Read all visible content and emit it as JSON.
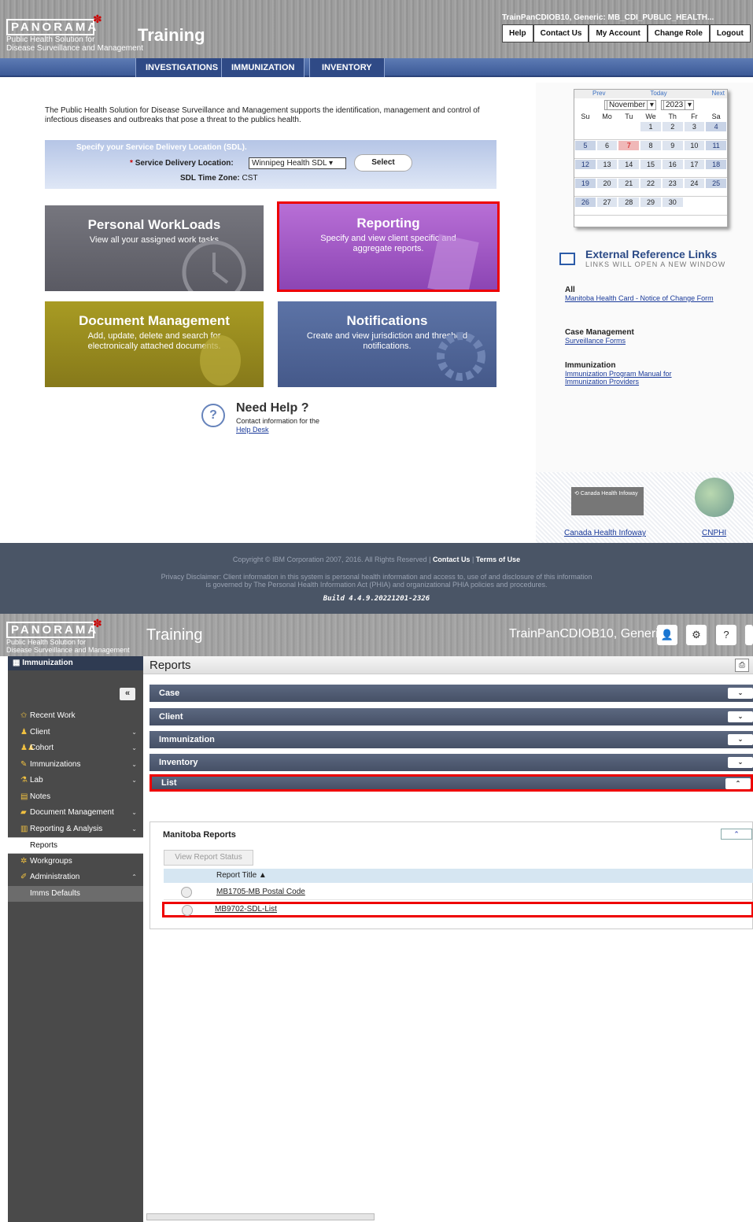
{
  "top": {
    "logo": {
      "word": "PANORAMA",
      "tagline_1": "Public Health Solution for",
      "tagline_2": "Disease Surveillance and Management"
    },
    "site_title": "Training",
    "user": "TrainPanCDIOB10, Generic: MB_CDI_PUBLIC_HEALTH...",
    "buttons": [
      "Help",
      "Contact Us",
      "My Account",
      "Change Role",
      "Logout"
    ],
    "nav": [
      "INVESTIGATIONS",
      "IMMUNIZATION",
      "INVENTORY"
    ],
    "intro": "The Public Health Solution for Disease Surveillance and Management supports the identification, management and control of infectious diseases and outbreaks that pose a threat to the publics health.",
    "sdl": {
      "heading": "Specify your Service Delivery Location (SDL).",
      "label": "Service Delivery Location:",
      "value": "Winnipeg Health SDL",
      "select": "Select",
      "tz_label": "SDL Time Zone:",
      "tz_value": "CST"
    },
    "tiles": [
      {
        "title": "Personal WorkLoads",
        "desc": "View all your assigned work tasks"
      },
      {
        "title": "Reporting",
        "desc": "Specify and view client specific and aggregate reports."
      },
      {
        "title": "Document Management",
        "desc": "Add, update, delete and search for electronically attached documents."
      },
      {
        "title": "Notifications",
        "desc": "Create and view jurisdiction and threshold notifications."
      }
    ],
    "help": {
      "title": "Need Help ?",
      "sub": "Contact information for the",
      "link": "Help Desk"
    },
    "calendar": {
      "prev": "Prev",
      "today": "Today",
      "next": "Next",
      "month": "November",
      "year": "2023",
      "days": [
        "Su",
        "Mo",
        "Tu",
        "We",
        "Th",
        "Fr",
        "Sa"
      ],
      "weeks": [
        [
          "",
          "",
          "",
          "1",
          "2",
          "3",
          "4"
        ],
        [
          "5",
          "6",
          "7",
          "8",
          "9",
          "10",
          "11"
        ],
        [
          "12",
          "13",
          "14",
          "15",
          "16",
          "17",
          "18"
        ],
        [
          "19",
          "20",
          "21",
          "22",
          "23",
          "24",
          "25"
        ],
        [
          "26",
          "27",
          "28",
          "29",
          "30",
          "",
          ""
        ]
      ]
    },
    "ext": {
      "title": "External Reference Links",
      "sub": "LINKS WILL OPEN A NEW WINDOW",
      "g1": "All",
      "l1": "Manitoba Health Card - Notice of Change Form",
      "g2": "Case Management",
      "l2": "Surveillance Forms",
      "g3": "Immunization",
      "l3": "Immunization Program Manual for Immunization Providers"
    },
    "logos": {
      "l1": "Canada Health Infoway",
      "l2": "CNPHI"
    },
    "footer": {
      "copy": "Copyright © IBM Corporation 2007, 2016. All Rights Reserved",
      "contact": "Contact Us",
      "terms": "Terms of Use",
      "privacy1": "Privacy Disclaimer: Client information in this system is personal health information and access to, use of and disclosure of this information",
      "privacy2": "is governed by The Personal Health Information Act (PHIA) and organizational PHIA policies and procedures.",
      "build": "Build 4.4.9.20221201-2326"
    }
  },
  "bottom": {
    "site_title": "Training",
    "user": "TrainPanCDIOB10, Generic",
    "sidebar": {
      "module": "Immunization",
      "items": [
        {
          "label": "Recent Work",
          "icon": "star-icon"
        },
        {
          "label": "Client",
          "icon": "person-icon",
          "chev": "⌄"
        },
        {
          "label": "Cohort",
          "icon": "group-icon",
          "chev": "⌄"
        },
        {
          "label": "Immunizations",
          "icon": "syringe-icon",
          "chev": "⌄"
        },
        {
          "label": "Lab",
          "icon": "flask-icon",
          "chev": "⌄"
        },
        {
          "label": "Notes",
          "icon": "note-icon"
        },
        {
          "label": "Document Management",
          "icon": "folder-icon",
          "chev": "⌄"
        },
        {
          "label": "Reporting & Analysis",
          "icon": "chart-icon",
          "chev": "⌄"
        },
        {
          "label": "Reports",
          "sub": true
        },
        {
          "label": "Workgroups",
          "icon": "workgroup-icon"
        },
        {
          "label": "Administration",
          "icon": "wrench-icon",
          "chev": "⌃"
        },
        {
          "label": "Imms Defaults",
          "sub2": true
        }
      ]
    },
    "page_title": "Reports",
    "sections": [
      "Case",
      "Client",
      "Immunization",
      "Inventory",
      "List"
    ],
    "list": {
      "title": "Manitoba Reports",
      "view_btn": "View Report Status",
      "col": "Report Title ▲",
      "rows": [
        "MB1705-MB Postal Code",
        "MB9702-SDL-List"
      ]
    }
  }
}
